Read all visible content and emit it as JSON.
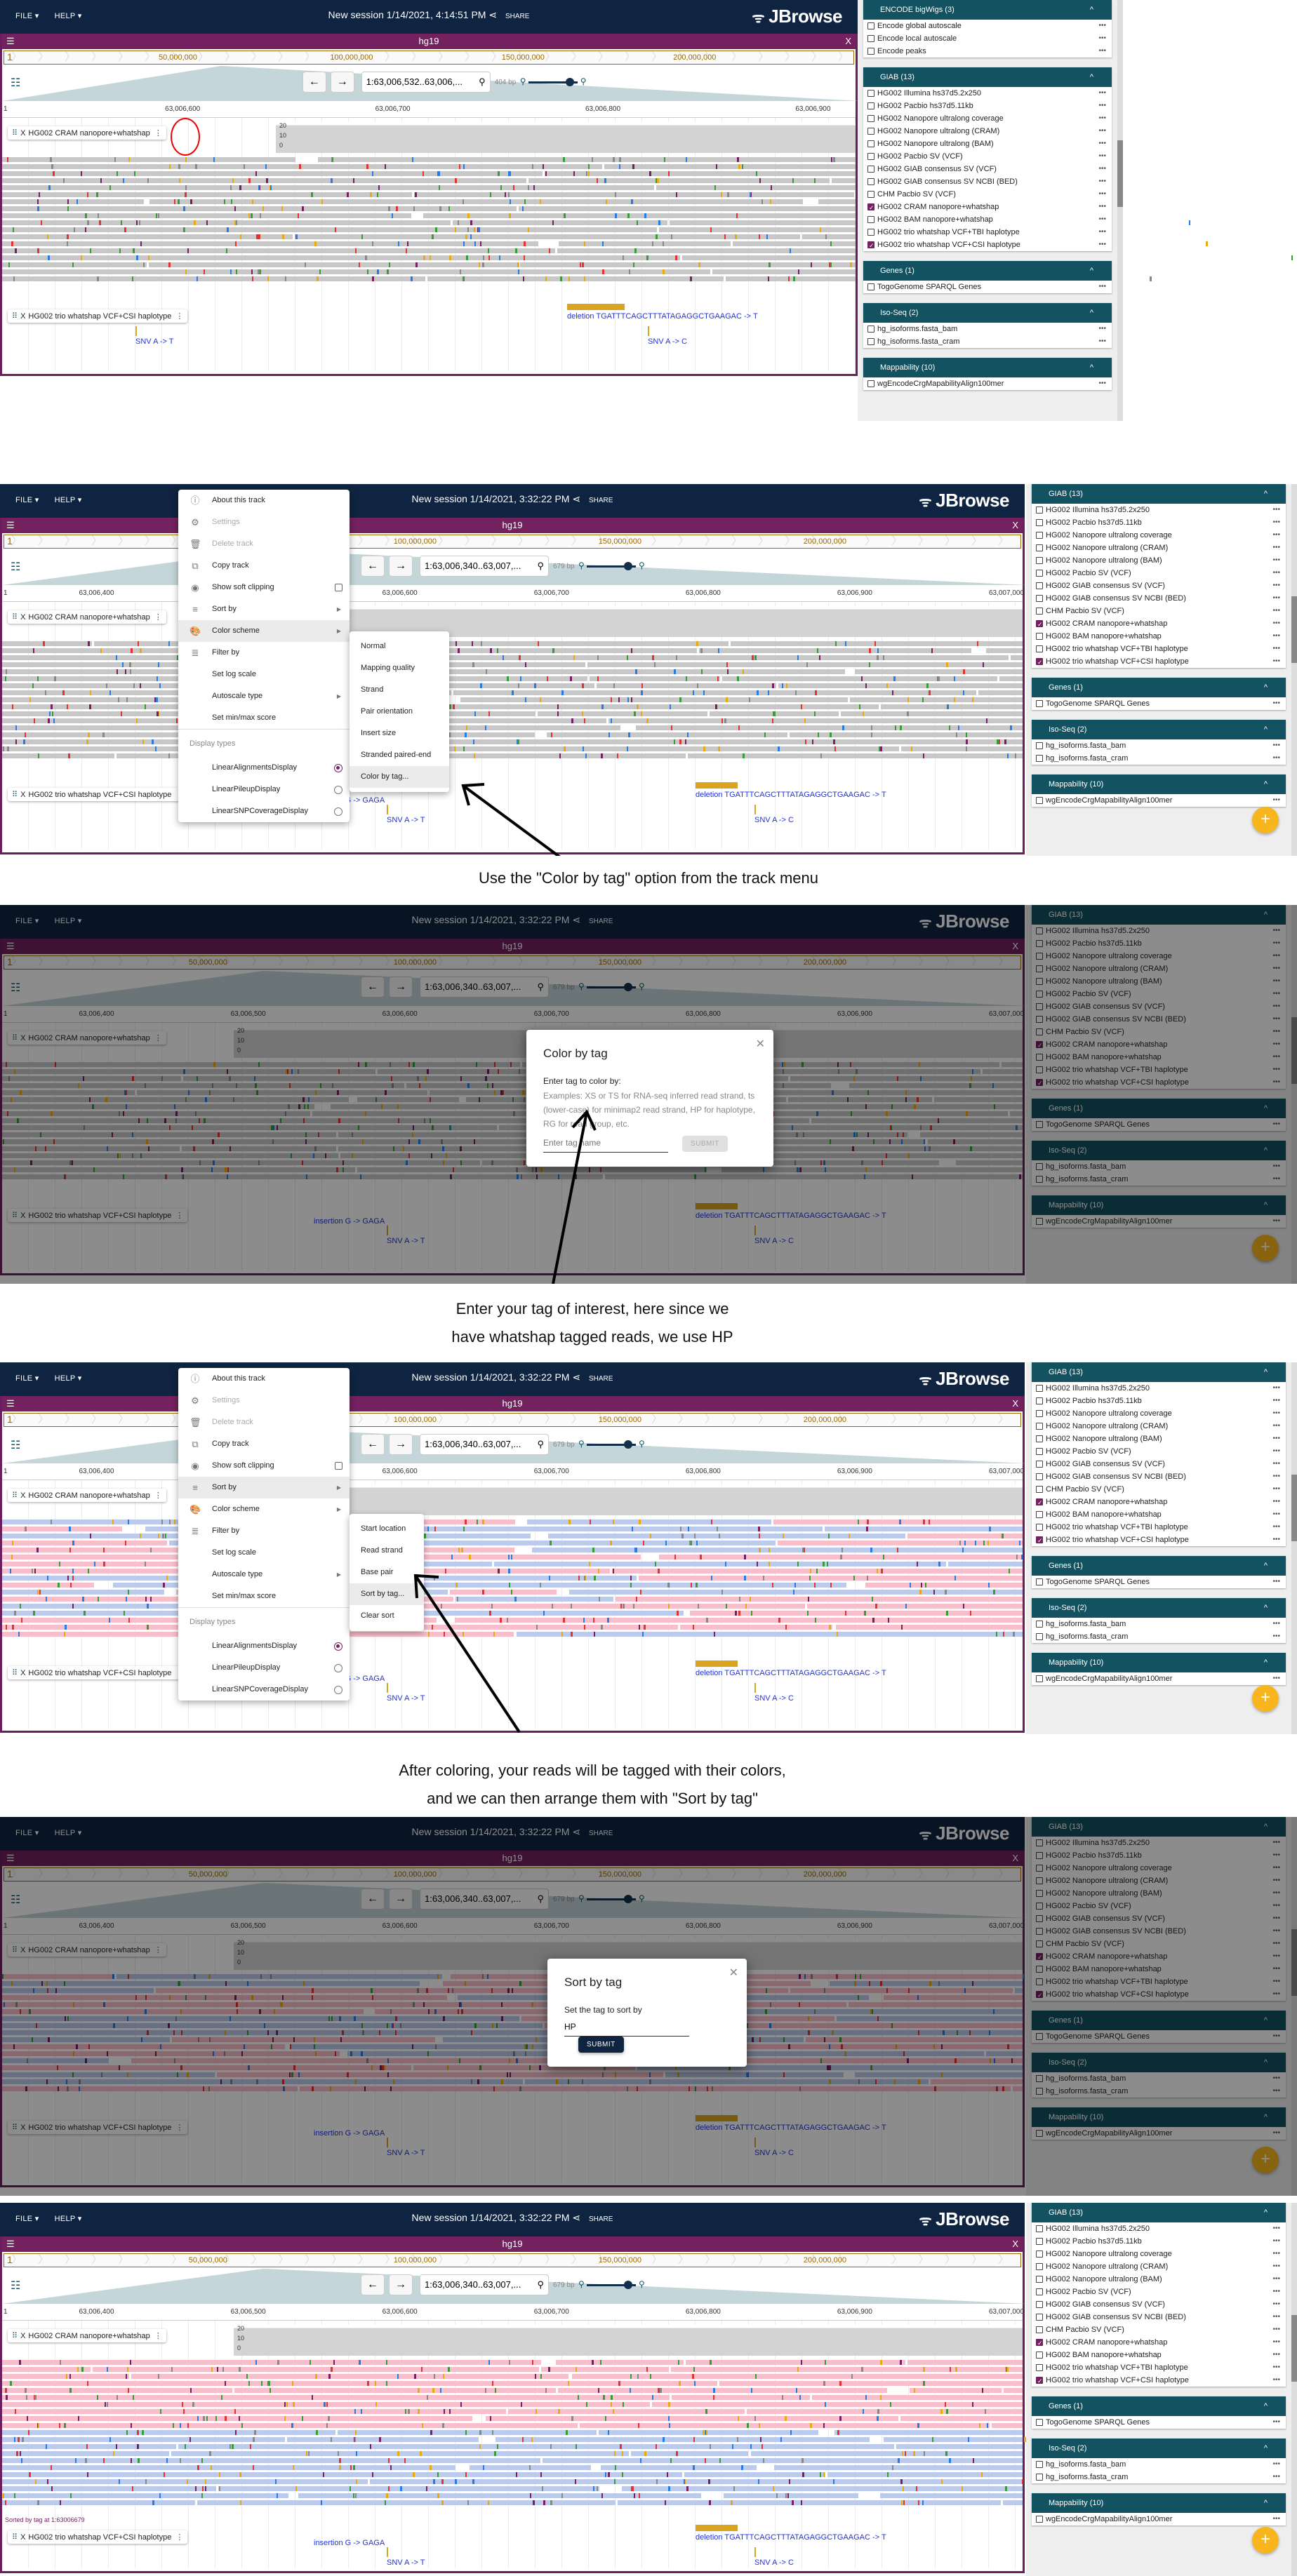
{
  "app": {
    "file_menu": "FILE ▾",
    "help_menu": "HELP ▾",
    "share": "SHARE",
    "logo": "JBrowse",
    "view_title": "hg19",
    "chromosome": "1",
    "overview_labels": [
      "50,000,000",
      "100,000,000",
      "150,000,000",
      "200,000,000"
    ]
  },
  "screens": [
    {
      "session": "New session 1/14/2021, 4:14:51 PM",
      "locus": "1:63,006,532..63,006,...",
      "bp": "404 bp",
      "ruler": [
        "63,006,600",
        "63,006,700",
        "63,006,800",
        "63,006,900"
      ],
      "coverage_scale": [
        "20",
        "10",
        "0"
      ]
    },
    {
      "session": "New session 1/14/2021, 3:32:22 PM",
      "locus": "1:63,006,340..63,007,...",
      "bp": "679 bp",
      "ruler": [
        "63,006,400",
        "63,006,500",
        "63,006,600",
        "63,006,700",
        "63,006,800",
        "63,006,900",
        "63,007,000"
      ],
      "coverage_scale": [
        "20",
        "10",
        "0"
      ]
    }
  ],
  "tracks": {
    "alignments": "HG002 CRAM nanopore+whatshap",
    "variants": "HG002 trio whatshap VCF+CSI haplotype"
  },
  "variants": {
    "insertion": "insertion G -> GAGA",
    "snv1": "SNV A -> T",
    "deletion": "deletion TGATTTCAGCTTTATAGAGGCTGAAGAC -> T",
    "snv2": "SNV A -> C"
  },
  "sort_note": "Sorted by tag at 1:63006679",
  "track_menu": {
    "items": [
      {
        "label": "About this track",
        "icon": "info-icon",
        "glyph": "ⓘ",
        "disabled": false
      },
      {
        "label": "Settings",
        "icon": "gear-icon",
        "glyph": "⚙",
        "disabled": true
      },
      {
        "label": "Delete track",
        "icon": "trash-icon",
        "glyph": "🗑",
        "disabled": true
      },
      {
        "label": "Copy track",
        "icon": "copy-icon",
        "glyph": "⧉",
        "disabled": false
      },
      {
        "label": "Show soft clipping",
        "icon": "eye-icon",
        "glyph": "◉",
        "disabled": false
      },
      {
        "label": "Sort by",
        "icon": "sort-icon",
        "glyph": "≡",
        "disabled": false
      },
      {
        "label": "Color scheme",
        "icon": "palette-icon",
        "glyph": "🎨",
        "disabled": false
      },
      {
        "label": "Filter by",
        "icon": "filter-icon",
        "glyph": "≣",
        "disabled": false
      },
      {
        "label": "Set log scale",
        "icon": "",
        "glyph": "",
        "disabled": false
      },
      {
        "label": "Autoscale type",
        "icon": "",
        "glyph": "",
        "disabled": false
      },
      {
        "label": "Set min/max score",
        "icon": "",
        "glyph": "",
        "disabled": false
      }
    ],
    "display_types_header": "Display types",
    "display_types": [
      "LinearAlignmentsDisplay",
      "LinearPileupDisplay",
      "LinearSNPCoverageDisplay"
    ],
    "selected_display": "LinearAlignmentsDisplay"
  },
  "color_scheme_menu": [
    "Normal",
    "Mapping quality",
    "Strand",
    "Pair orientation",
    "Insert size",
    "Stranded paired-end",
    "Color by tag..."
  ],
  "sort_by_menu": [
    "Start location",
    "Read strand",
    "Base pair",
    "Sort by tag...",
    "Clear sort"
  ],
  "color_dialog": {
    "title": "Color by tag",
    "label": "Enter tag to color by:",
    "help": "Examples: XS or TS for RNA-seq inferred read strand, ts (lower-case) for minimap2 read strand, HP for haplotype, RG for read group, etc.",
    "placeholder": "Enter tag name",
    "submit": "SUBMIT"
  },
  "sort_dialog": {
    "title": "Sort by tag",
    "label": "Set the tag to sort by",
    "value": "HP",
    "submit": "SUBMIT"
  },
  "captions": [
    "Use the \"Color by tag\" option from the track menu",
    "Enter your tag of interest, here since we",
    "have whatshap tagged reads, we use HP",
    "After coloring, your reads will be tagged with their colors,",
    "and we can then arrange them with \"Sort by tag\""
  ],
  "sidebar": {
    "encode": {
      "title": "ENCODE bigWigs (3)",
      "items": [
        {
          "label": "Encode global autoscale",
          "checked": false
        },
        {
          "label": "Encode local autoscale",
          "checked": false
        },
        {
          "label": "Encode peaks",
          "checked": false
        }
      ]
    },
    "giab": {
      "title": "GIAB (13)",
      "items": [
        {
          "label": "HG002 Illumina hs37d5.2x250",
          "checked": false
        },
        {
          "label": "HG002 Pacbio hs37d5.11kb",
          "checked": false
        },
        {
          "label": "HG002 Nanopore ultralong coverage",
          "checked": false
        },
        {
          "label": "HG002 Nanopore ultralong (CRAM)",
          "checked": false
        },
        {
          "label": "HG002 Nanopore ultralong (BAM)",
          "checked": false
        },
        {
          "label": "HG002 Pacbio SV (VCF)",
          "checked": false
        },
        {
          "label": "HG002 GIAB consensus SV (VCF)",
          "checked": false
        },
        {
          "label": "HG002 GIAB consensus SV NCBI (BED)",
          "checked": false
        },
        {
          "label": "CHM Pacbio SV (VCF)",
          "checked": false
        },
        {
          "label": "HG002 CRAM nanopore+whatshap",
          "checked": true
        },
        {
          "label": "HG002 BAM nanopore+whatshap",
          "checked": false
        },
        {
          "label": "HG002 trio whatshap VCF+TBI haplotype",
          "checked": false
        },
        {
          "label": "HG002 trio whatshap VCF+CSI haplotype",
          "checked": true
        }
      ]
    },
    "genes": {
      "title": "Genes (1)",
      "items": [
        {
          "label": "TogoGenome SPARQL Genes",
          "checked": false
        }
      ]
    },
    "isoseq": {
      "title": "Iso-Seq (2)",
      "items": [
        {
          "label": "hg_isoforms.fasta_bam",
          "checked": false
        },
        {
          "label": "hg_isoforms.fasta_cram",
          "checked": false
        }
      ]
    },
    "mappability": {
      "title": "Mappability (10)",
      "items": [
        {
          "label": "wgEncodeCrgMapabilityAlign100mer",
          "checked": false
        }
      ]
    },
    "more_glyph": "•••",
    "caret_glyph": "^",
    "add_glyph": "+"
  },
  "colors": {
    "appbar": "#0f2440",
    "view_header": "#73215f",
    "sidebar_header": "#135361",
    "fab": "#f8b51e",
    "hp1_read": "#f7bfcc",
    "hp2_read": "#bccbeb",
    "variant": "#d9a521",
    "variant_label": "#2233dd"
  }
}
